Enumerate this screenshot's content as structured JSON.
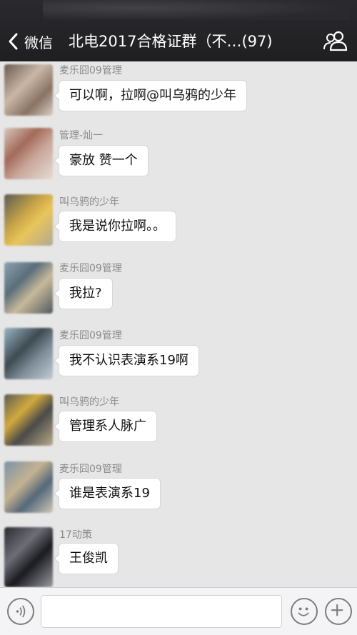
{
  "header": {
    "back_label": "微信",
    "title": "北电2017合格证群（不…(97)"
  },
  "messages": [
    {
      "sender": "麦乐囧09管理",
      "text": "可以啊，拉啊@叫乌鸦的少年"
    },
    {
      "sender": "管理-灿一",
      "text": "豪放 赞一个"
    },
    {
      "sender": "叫乌鸦的少年",
      "text": "我是说你拉啊。。"
    },
    {
      "sender": "麦乐囧09管理",
      "text": "我拉?"
    },
    {
      "sender": "麦乐囧09管理",
      "text": "我不认识表演系19啊"
    },
    {
      "sender": "叫乌鸦的少年",
      "text": "管理系人脉广"
    },
    {
      "sender": "麦乐囧09管理",
      "text": "谁是表演系19"
    },
    {
      "sender": "17动策",
      "text": "王俊凯"
    }
  ],
  "icons": {
    "back": "chevron-left-icon",
    "group": "group-members-icon",
    "voice": "voice-icon",
    "emoji": "emoji-icon",
    "more": "plus-icon"
  }
}
